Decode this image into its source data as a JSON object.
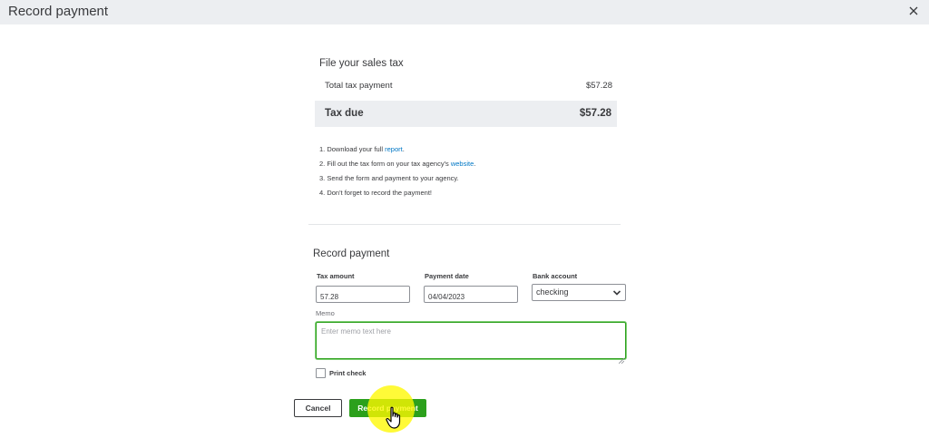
{
  "dialog": {
    "title": "Record payment"
  },
  "tax_summary": {
    "heading": "File your sales tax",
    "total_label": "Total tax payment",
    "total_value": "$57.28",
    "due_label": "Tax due",
    "due_value": "$57.28"
  },
  "steps": [
    {
      "prefix": "1. Download your full ",
      "link": "report",
      "suffix": "."
    },
    {
      "prefix": "2. Fill out the tax form on your tax agency's ",
      "link": "website",
      "suffix": "."
    },
    {
      "text": "3. Send the form and payment to your agency."
    },
    {
      "text": "4. Don't forget to record the payment!"
    }
  ],
  "record_form": {
    "heading": "Record payment",
    "tax_amount_label": "Tax amount",
    "tax_amount_value": "57.28",
    "payment_date_label": "Payment date",
    "payment_date_value": "04/04/2023",
    "bank_account_label": "Bank account",
    "bank_account_value": "checking",
    "memo_label": "Memo",
    "memo_placeholder": "Enter memo text here",
    "print_check_label": "Print check"
  },
  "actions": {
    "cancel_label": "Cancel",
    "record_label": "Record payment"
  },
  "colors": {
    "header_bg": "#eceef1",
    "primary": "#2ca01c",
    "link": "#0077c5",
    "click_highlight": "#fff900"
  }
}
